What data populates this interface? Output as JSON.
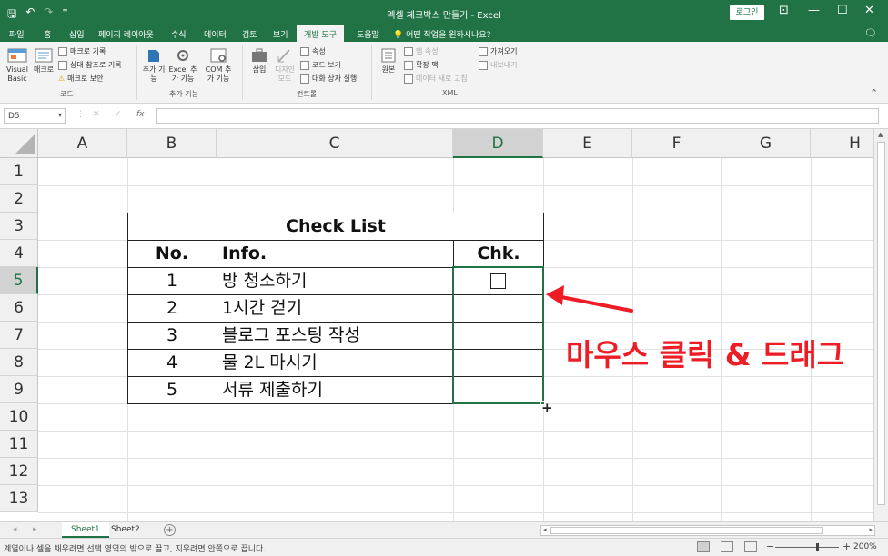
{
  "window": {
    "title": "엑셀 체크박스 만들기 - Excel",
    "login_label": "로그인",
    "qat": {
      "save": "🖫",
      "undo": "↶",
      "redo": "↷",
      "customize": "⁼"
    },
    "controls": {
      "display_options": "⊡",
      "minimize": "—",
      "maximize": "☐",
      "close": "✕"
    }
  },
  "tabs": [
    {
      "label": "파일"
    },
    {
      "label": "홈"
    },
    {
      "label": "삽입"
    },
    {
      "label": "페이지 레이아웃"
    },
    {
      "label": "수식"
    },
    {
      "label": "데이터"
    },
    {
      "label": "검토"
    },
    {
      "label": "보기"
    },
    {
      "label": "개발 도구",
      "active": true
    },
    {
      "label": "도움말"
    }
  ],
  "tell_me": "어떤 작업을 원하시나요?",
  "ribbon": {
    "code": {
      "visual_basic": "Visual Basic",
      "macro": "매크로",
      "record_macro": "매크로 기록",
      "relative_ref": "상대 참조로 기록",
      "macro_security": "매크로 보안",
      "group_label": "코드"
    },
    "addins": {
      "addins": "추가 기능",
      "excel_addins": "Excel 추가 기능",
      "com_addins": "COM 추가 기능",
      "group_label": "추가 기능"
    },
    "controls": {
      "insert": "삽입",
      "design_mode": "디자인 모드",
      "properties": "속성",
      "view_code": "코드 보기",
      "run_dialog": "대화 상자 실행",
      "group_label": "컨트롤"
    },
    "xml": {
      "source": "원본",
      "map_properties": "맵 속성",
      "expansion_packs": "확장 팩",
      "refresh_data": "데이터 새로 고침",
      "import": "가져오기",
      "export": "내보내기",
      "group_label": "XML"
    }
  },
  "formula_bar": {
    "name_box": "D5",
    "cancel": "✕",
    "enter": "✓",
    "fx": "fx",
    "value": ""
  },
  "columns": [
    "A",
    "B",
    "C",
    "D",
    "E",
    "F",
    "G",
    "H"
  ],
  "selected_column": "D",
  "rows": [
    "1",
    "2",
    "3",
    "4",
    "5",
    "6",
    "7",
    "8",
    "9",
    "10",
    "11",
    "12",
    "13"
  ],
  "selected_row": "5",
  "table": {
    "title": "Check List",
    "headers": {
      "no": "No.",
      "info": "Info.",
      "chk": "Chk."
    },
    "items": [
      {
        "no": "1",
        "info": "방 청소하기"
      },
      {
        "no": "2",
        "info": "1시간 걷기"
      },
      {
        "no": "3",
        "info": "블로그 포스팅 작성"
      },
      {
        "no": "4",
        "info": "물 2L 마시기"
      },
      {
        "no": "5",
        "info": "서류 제출하기"
      }
    ]
  },
  "annotation": {
    "text": "마우스 클릭 & 드래그",
    "color": "#ee1c24"
  },
  "sheets": [
    {
      "label": "Sheet1",
      "active": true
    },
    {
      "label": "Sheet2",
      "active": false
    }
  ],
  "status": {
    "message": "계열이나 셀을 채우려면 선택 영역의 밖으로 끌고, 지우려면 안쪽으로 끕니다.",
    "zoom": "200%"
  },
  "colors": {
    "accent": "#217346",
    "annotation": "#ee1c24"
  }
}
